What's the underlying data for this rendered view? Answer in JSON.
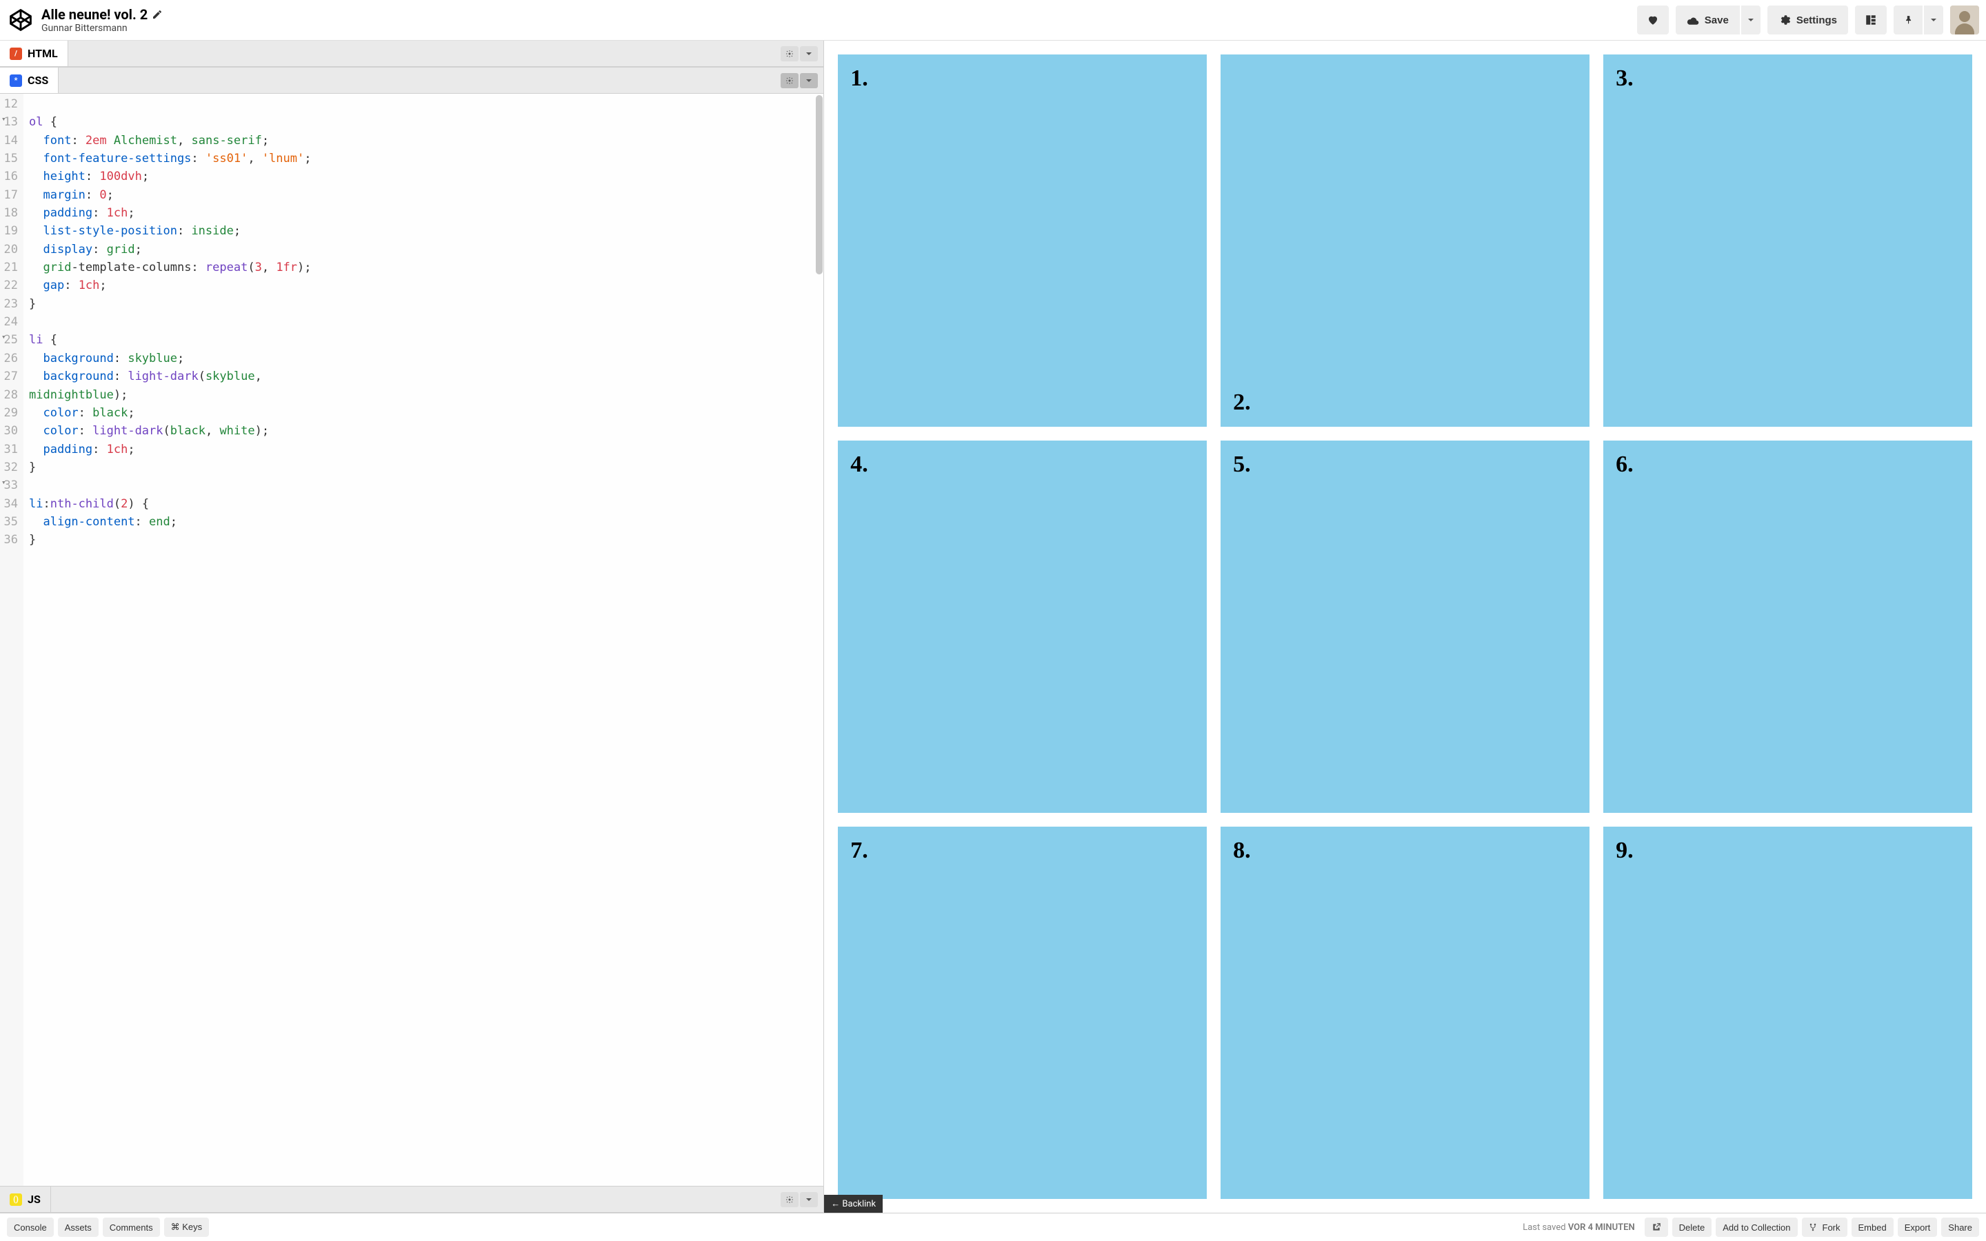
{
  "header": {
    "title": "Alle neune! vol. 2",
    "author": "Gunnar Bittersmann",
    "love_label": "",
    "save_label": "Save",
    "settings_label": "Settings"
  },
  "panels": {
    "html": "HTML",
    "css": "CSS",
    "js": "JS"
  },
  "code": {
    "lines": [
      {
        "n": "12",
        "t": "",
        "fold": false
      },
      {
        "n": "13",
        "t": "ol {",
        "fold": true
      },
      {
        "n": "14",
        "t": "  font: 2em Alchemist, sans-serif;",
        "fold": false
      },
      {
        "n": "15",
        "t": "  font-feature-settings: 'ss01', 'lnum';",
        "fold": false
      },
      {
        "n": "16",
        "t": "  height: 100dvh;",
        "fold": false
      },
      {
        "n": "17",
        "t": "  margin: 0;",
        "fold": false
      },
      {
        "n": "18",
        "t": "  padding: 1ch;",
        "fold": false
      },
      {
        "n": "19",
        "t": "  list-style-position: inside;",
        "fold": false
      },
      {
        "n": "20",
        "t": "  display: grid;",
        "fold": false
      },
      {
        "n": "21",
        "t": "  grid-template-columns: repeat(3, 1fr);",
        "fold": false
      },
      {
        "n": "22",
        "t": "  gap: 1ch;",
        "fold": false
      },
      {
        "n": "23",
        "t": "}",
        "fold": false
      },
      {
        "n": "24",
        "t": "",
        "fold": false
      },
      {
        "n": "25",
        "t": "li {",
        "fold": true
      },
      {
        "n": "26",
        "t": "  background: skyblue;",
        "fold": false
      },
      {
        "n": "27",
        "t": "  background: light-dark(skyblue, midnightblue);",
        "fold": false,
        "wrap": true
      },
      {
        "n": "28",
        "t": "  color: black;",
        "fold": false
      },
      {
        "n": "29",
        "t": "  color: light-dark(black, white);",
        "fold": false
      },
      {
        "n": "30",
        "t": "  padding: 1ch;",
        "fold": false
      },
      {
        "n": "31",
        "t": "}",
        "fold": false
      },
      {
        "n": "32",
        "t": "",
        "fold": false
      },
      {
        "n": "33",
        "t": "li:nth-child(2) {",
        "fold": true
      },
      {
        "n": "34",
        "t": "  align-content: end;",
        "fold": false
      },
      {
        "n": "35",
        "t": "}",
        "fold": false
      },
      {
        "n": "36",
        "t": "",
        "fold": false
      }
    ]
  },
  "preview": {
    "tiles": [
      "1.",
      "2.",
      "3.",
      "4.",
      "5.",
      "6.",
      "7.",
      "8.",
      "9."
    ],
    "backlink": "← Backlink"
  },
  "footer": {
    "console": "Console",
    "assets": "Assets",
    "comments": "Comments",
    "keys": "⌘ Keys",
    "last_saved_label": "Last saved ",
    "last_saved_time": "VOR 4 MINUTEN",
    "delete": "Delete",
    "add_collection": "Add to Collection",
    "fork": "Fork",
    "embed": "Embed",
    "export": "Export",
    "share": "Share"
  }
}
